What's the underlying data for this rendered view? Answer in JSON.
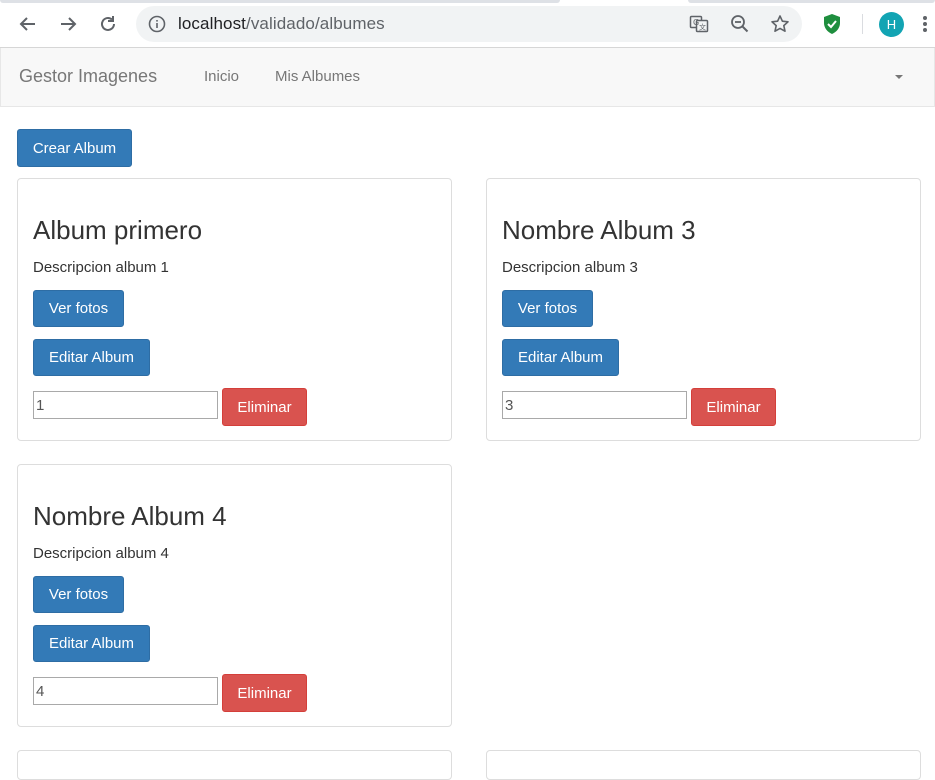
{
  "browser": {
    "url_host": "localhost",
    "url_path": "/validado/albumes",
    "avatar_initial": "H",
    "colors": {
      "avatar": "#12a4b3",
      "shield": "#1e8e3e"
    }
  },
  "navbar": {
    "brand": "Gestor Imagenes",
    "links": [
      "Inicio",
      "Mis Albumes"
    ]
  },
  "actions": {
    "create_album": "Crear Album"
  },
  "albums": [
    {
      "title": "Album primero",
      "description": "Descripcion album 1",
      "view_label": "Ver fotos",
      "edit_label": "Editar Album",
      "id_value": "1",
      "delete_label": "Eliminar"
    },
    {
      "title": "Nombre Album 3",
      "description": "Descripcion album 3",
      "view_label": "Ver fotos",
      "edit_label": "Editar Album",
      "id_value": "3",
      "delete_label": "Eliminar"
    },
    {
      "title": "Nombre Album 4",
      "description": "Descripcion album 4",
      "view_label": "Ver fotos",
      "edit_label": "Editar Album",
      "id_value": "4",
      "delete_label": "Eliminar"
    }
  ],
  "colors": {
    "primary": "#337ab7",
    "danger": "#d9534f",
    "navbar_bg": "#f8f8f8"
  }
}
